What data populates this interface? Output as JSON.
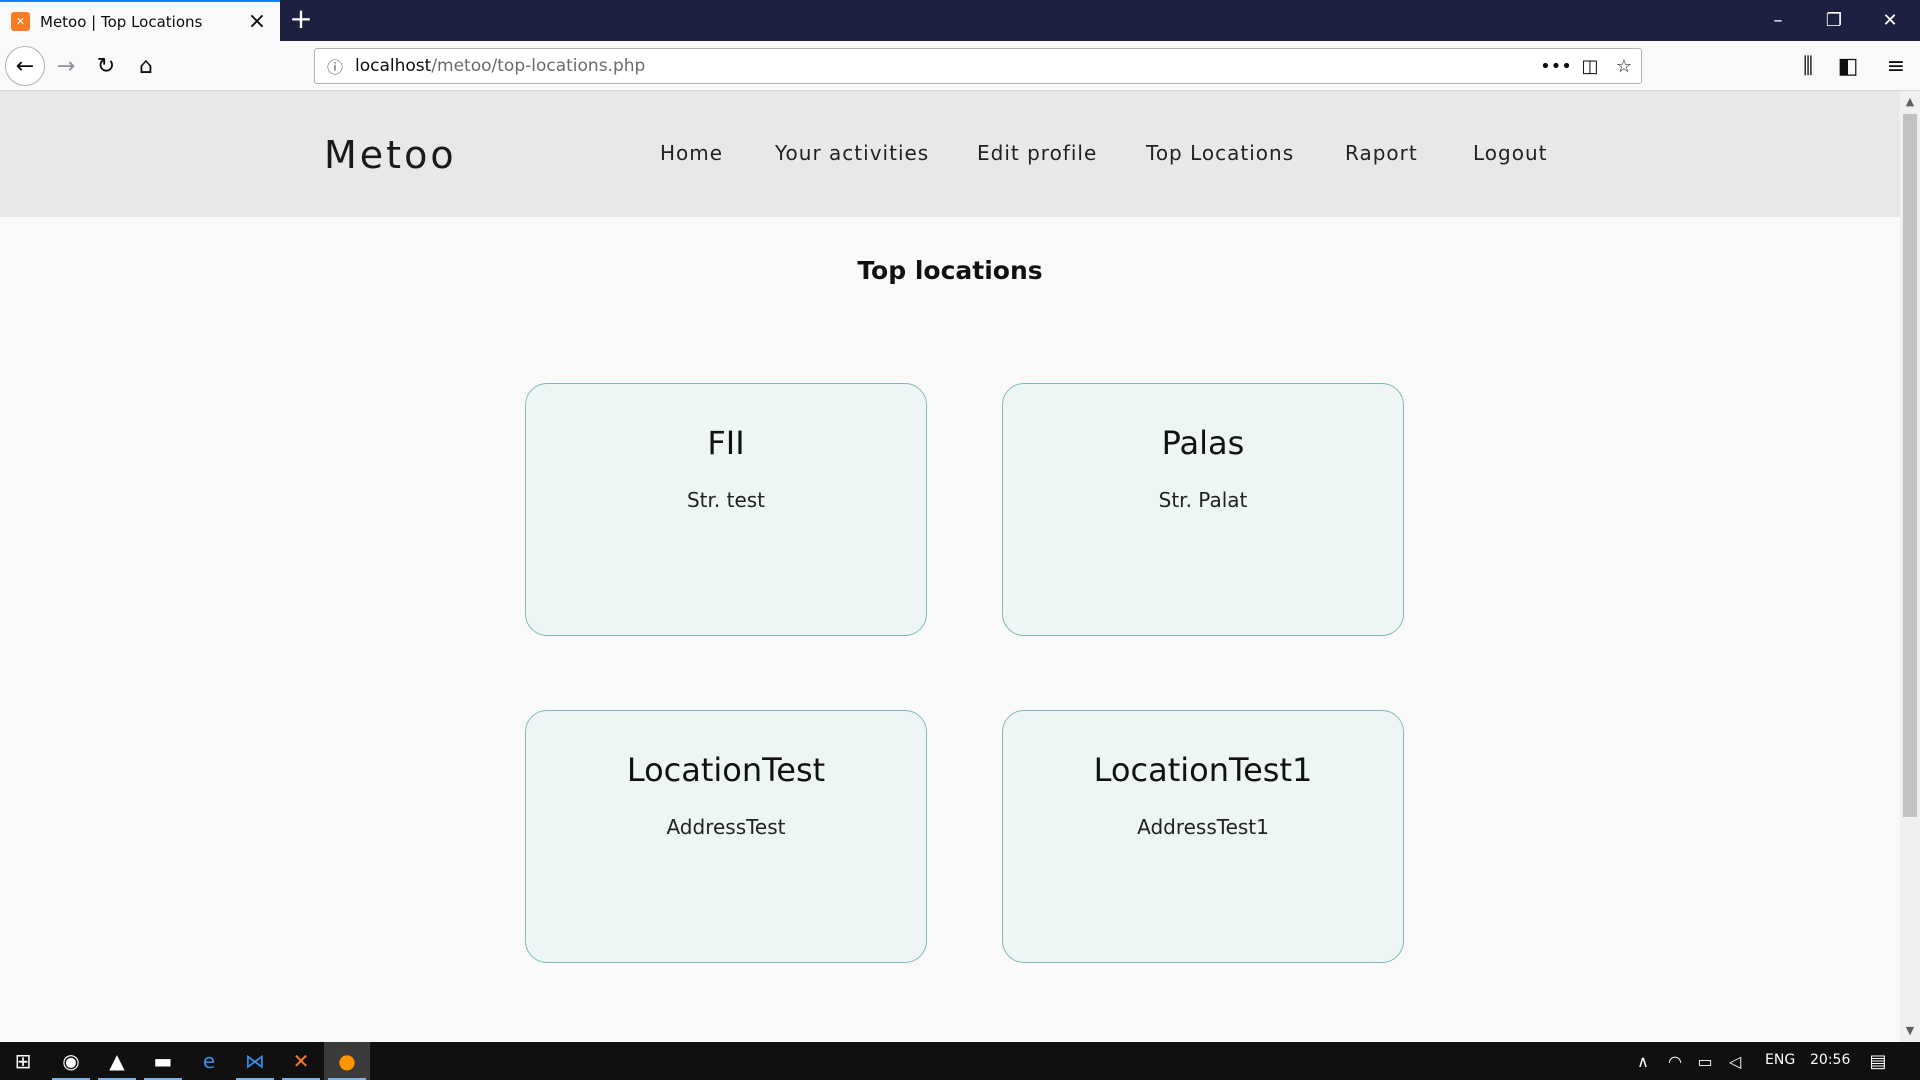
{
  "browser": {
    "tab_title": "Metoo | Top Locations",
    "url_host": "localhost",
    "url_path": "/metoo/top-locations.php"
  },
  "site": {
    "brand": "Metoo",
    "menu": [
      "Home",
      "Your activities",
      "Edit profile",
      "Top Locations",
      "Raport",
      "Logout"
    ]
  },
  "page": {
    "title": "Top locations",
    "locations": [
      {
        "name": "FII",
        "address": "Str. test"
      },
      {
        "name": "Palas",
        "address": "Str. Palat"
      },
      {
        "name": "LocationTest",
        "address": "AddressTest"
      },
      {
        "name": "LocationTest1",
        "address": "AddressTest1"
      }
    ]
  },
  "taskbar": {
    "language": "ENG",
    "time": "20:56"
  }
}
